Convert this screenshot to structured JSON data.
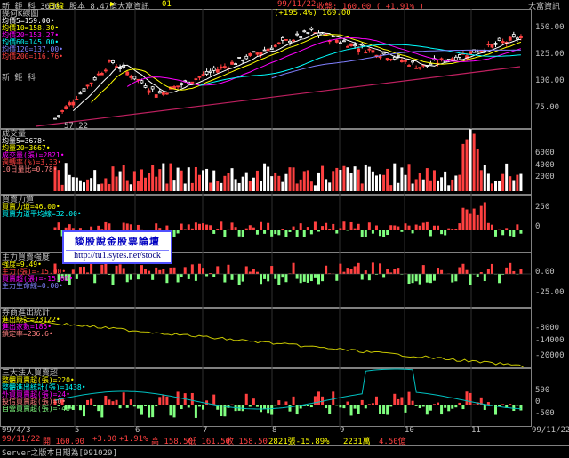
{
  "topbar": {
    "stock_name": "新 鉅 科 3630",
    "period": "日線",
    "capital": "股本 8.47億",
    "broker_arrow": "▶",
    "broker": "大富資訊",
    "index_num": "01",
    "date": "99/11/22",
    "close": "收盤: 160.00 ( +1.91% )",
    "right_brand": "大富資訊"
  },
  "main_panel": {
    "title": "幾何K線圖",
    "ma": [
      {
        "label": "均價5",
        "value": "159.00",
        "color": "#ffffff"
      },
      {
        "label": "均價10",
        "value": "158.30",
        "color": "#ffff00"
      },
      {
        "label": "均價20",
        "value": "153.27",
        "color": "#ff00ff"
      },
      {
        "label": "均價60",
        "value": "145.00",
        "color": "#00ffff"
      },
      {
        "label": "均價120",
        "value": "137.00",
        "color": "#8080ff"
      },
      {
        "label": "均價200",
        "value": "116.76",
        "color": "#ff4040"
      }
    ],
    "inner_label": "新 鉅 科",
    "peak_label": "(+195.4%) 169.00",
    "low_label": "57.22",
    "y_ticks": [
      "150.00",
      "125.00",
      "100.00",
      "75.00"
    ]
  },
  "volume_panel": {
    "title": "成交量",
    "items": [
      {
        "label": "均量5",
        "value": "3678",
        "color": "#ffffff"
      },
      {
        "label": "均量20",
        "value": "3667",
        "color": "#ffff00"
      },
      {
        "label": "成交量(張)",
        "value": "2821",
        "color": "#ff00ff"
      },
      {
        "label": "週轉率(%)",
        "value": "3.33",
        "color": "#ff4040"
      },
      {
        "label": "10日量比",
        "value": "0.78",
        "color": "#ff8080"
      }
    ],
    "y_ticks": [
      "6000",
      "4000",
      "2000"
    ]
  },
  "power_panel": {
    "title": "買賣力道",
    "items": [
      {
        "label": "買賣力道",
        "value": "46.00",
        "color": "#ffff00"
      },
      {
        "label": "買賣力道平均線",
        "value": "32.00",
        "color": "#00ffff"
      }
    ],
    "y_ticks": [
      "250",
      "0"
    ]
  },
  "logo": {
    "title": "談股說金股票論壇",
    "url": "http://tu1.sytes.net/stock"
  },
  "strength_panel": {
    "title": "主力買賣強度",
    "items": [
      {
        "label": "強度",
        "value": "9.49",
        "color": "#ffff00"
      },
      {
        "label": "主力(張)",
        "value": "-15.00",
        "color": "#ff4040"
      },
      {
        "label": "買賣超(張)",
        "value": "-15.00",
        "color": "#ff00ff"
      },
      {
        "label": "主力生命線",
        "value": "0.00",
        "color": "#8080ff"
      }
    ],
    "y_ticks": [
      "0.00",
      "-25.00"
    ]
  },
  "bond_panel": {
    "title": "券商進出統計",
    "items": [
      {
        "label": "進出統計",
        "value": "23122",
        "color": "#ffff00"
      },
      {
        "label": "進出家數",
        "value": "185",
        "color": "#ff00ff"
      },
      {
        "label": "鎖定率",
        "value": "236.6",
        "color": "#ff8080"
      }
    ],
    "y_ticks": [
      "-8000",
      "-14000",
      "-20000"
    ]
  },
  "inst_panel": {
    "title": "三大法人買賣超",
    "items": [
      {
        "label": "整體買賣超(張)",
        "value": "220",
        "color": "#ffff00"
      },
      {
        "label": "整體進出統計(張)",
        "value": "1438",
        "color": "#00ffff"
      },
      {
        "label": "外資買賣超(張)",
        "value": "24",
        "color": "#ff00ff"
      },
      {
        "label": "投信買賣超(張)",
        "value": "0",
        "color": "#ff8080"
      },
      {
        "label": "自營買賣超(張)",
        "value": "-43",
        "color": "#80ff80"
      }
    ],
    "y_ticks": [
      "500",
      "0",
      "-500"
    ]
  },
  "x_axis": {
    "start": "99/4/3",
    "months": [
      "5",
      "6",
      "7",
      "8",
      "9",
      "10",
      "11"
    ],
    "end": "99/11/22"
  },
  "bottombar": {
    "date": "99/11/22",
    "open": "開 160.00",
    "chg": "+3.00",
    "pct": "+1.91%",
    "high": "高 158.50",
    "low": "低 161.50",
    "close": "收 158.50",
    "vol": "2821張-15.89%",
    "amt": "2231萬",
    "ratio": "4.50億"
  },
  "statusbar": {
    "text": "Server之版本日期為[991029]"
  },
  "colors": {
    "up": "#ff4040",
    "down": "#80ff80",
    "neutral": "#ffffff",
    "bg": "#000000"
  }
}
